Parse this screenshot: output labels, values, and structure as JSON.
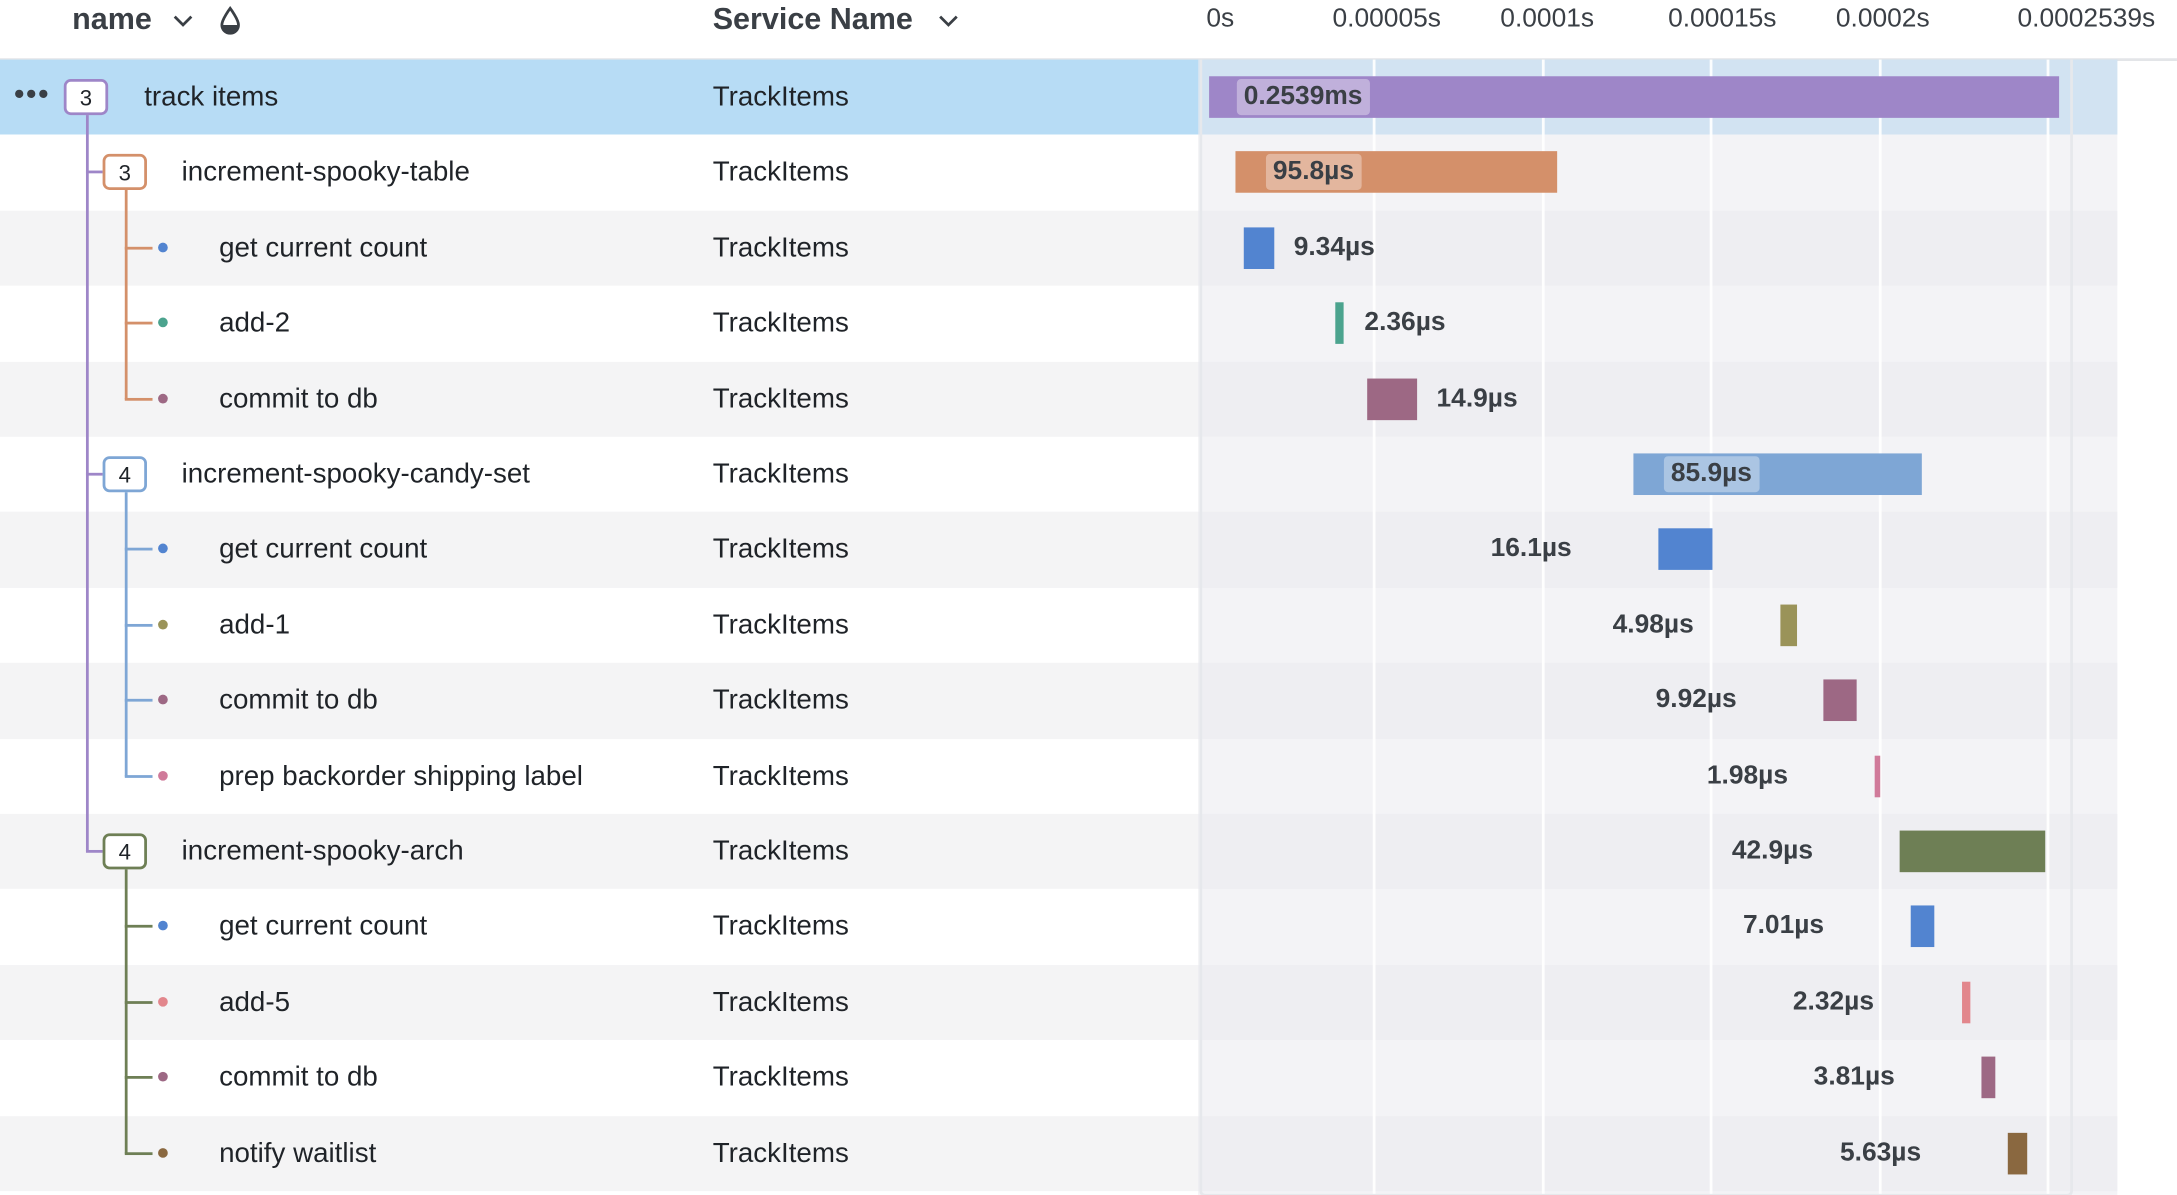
{
  "header": {
    "name_label": "name",
    "service_label": "Service Name",
    "name_sort_icon": "chevron-down-icon",
    "service_sort_icon": "chevron-down-icon",
    "color_icon": "droplet-icon",
    "ticks": [
      "0s",
      "0.00005s",
      "0.0001s",
      "0.00015s",
      "0.0002s",
      "0.0002539s"
    ]
  },
  "trace": {
    "total_duration_label": "0.2539ms",
    "spans": [
      {
        "name": "track items",
        "service": "TrackItems",
        "duration": "0.2539ms",
        "badge": "3",
        "color": "#9e86c8"
      },
      {
        "name": "increment-spooky-table",
        "service": "TrackItems",
        "duration": "95.8µs",
        "badge": "3",
        "color": "#d4906a"
      },
      {
        "name": "get current count",
        "service": "TrackItems",
        "duration": "9.34µs",
        "color": "#5284d0"
      },
      {
        "name": "add-2",
        "service": "TrackItems",
        "duration": "2.36µs",
        "color": "#4ba38e"
      },
      {
        "name": "commit to db",
        "service": "TrackItems",
        "duration": "14.9µs",
        "color": "#9d6884"
      },
      {
        "name": "increment-spooky-candy-set",
        "service": "TrackItems",
        "duration": "85.9µs",
        "badge": "4",
        "color": "#7ea6d5"
      },
      {
        "name": "get current count",
        "service": "TrackItems",
        "duration": "16.1µs",
        "color": "#5284d0"
      },
      {
        "name": "add-1",
        "service": "TrackItems",
        "duration": "4.98µs",
        "color": "#9a9359"
      },
      {
        "name": "commit to db",
        "service": "TrackItems",
        "duration": "9.92µs",
        "color": "#9d6884"
      },
      {
        "name": "prep backorder shipping label",
        "service": "TrackItems",
        "duration": "1.98µs",
        "color": "#d07a9a"
      },
      {
        "name": "increment-spooky-arch",
        "service": "TrackItems",
        "duration": "42.9µs",
        "badge": "4",
        "color": "#6e7f55"
      },
      {
        "name": "get current count",
        "service": "TrackItems",
        "duration": "7.01µs",
        "color": "#5284d0"
      },
      {
        "name": "add-5",
        "service": "TrackItems",
        "duration": "2.32µs",
        "color": "#e2868c"
      },
      {
        "name": "commit to db",
        "service": "TrackItems",
        "duration": "3.81µs",
        "color": "#9d6884"
      },
      {
        "name": "notify waitlist",
        "service": "TrackItems",
        "duration": "5.63µs",
        "color": "#8a6840"
      }
    ]
  },
  "colors": {
    "root": "#9e86c8",
    "table": "#d4906a",
    "candy": "#7ea6d5",
    "arch": "#6e7f55",
    "selected_row": "#b7dcf5"
  }
}
